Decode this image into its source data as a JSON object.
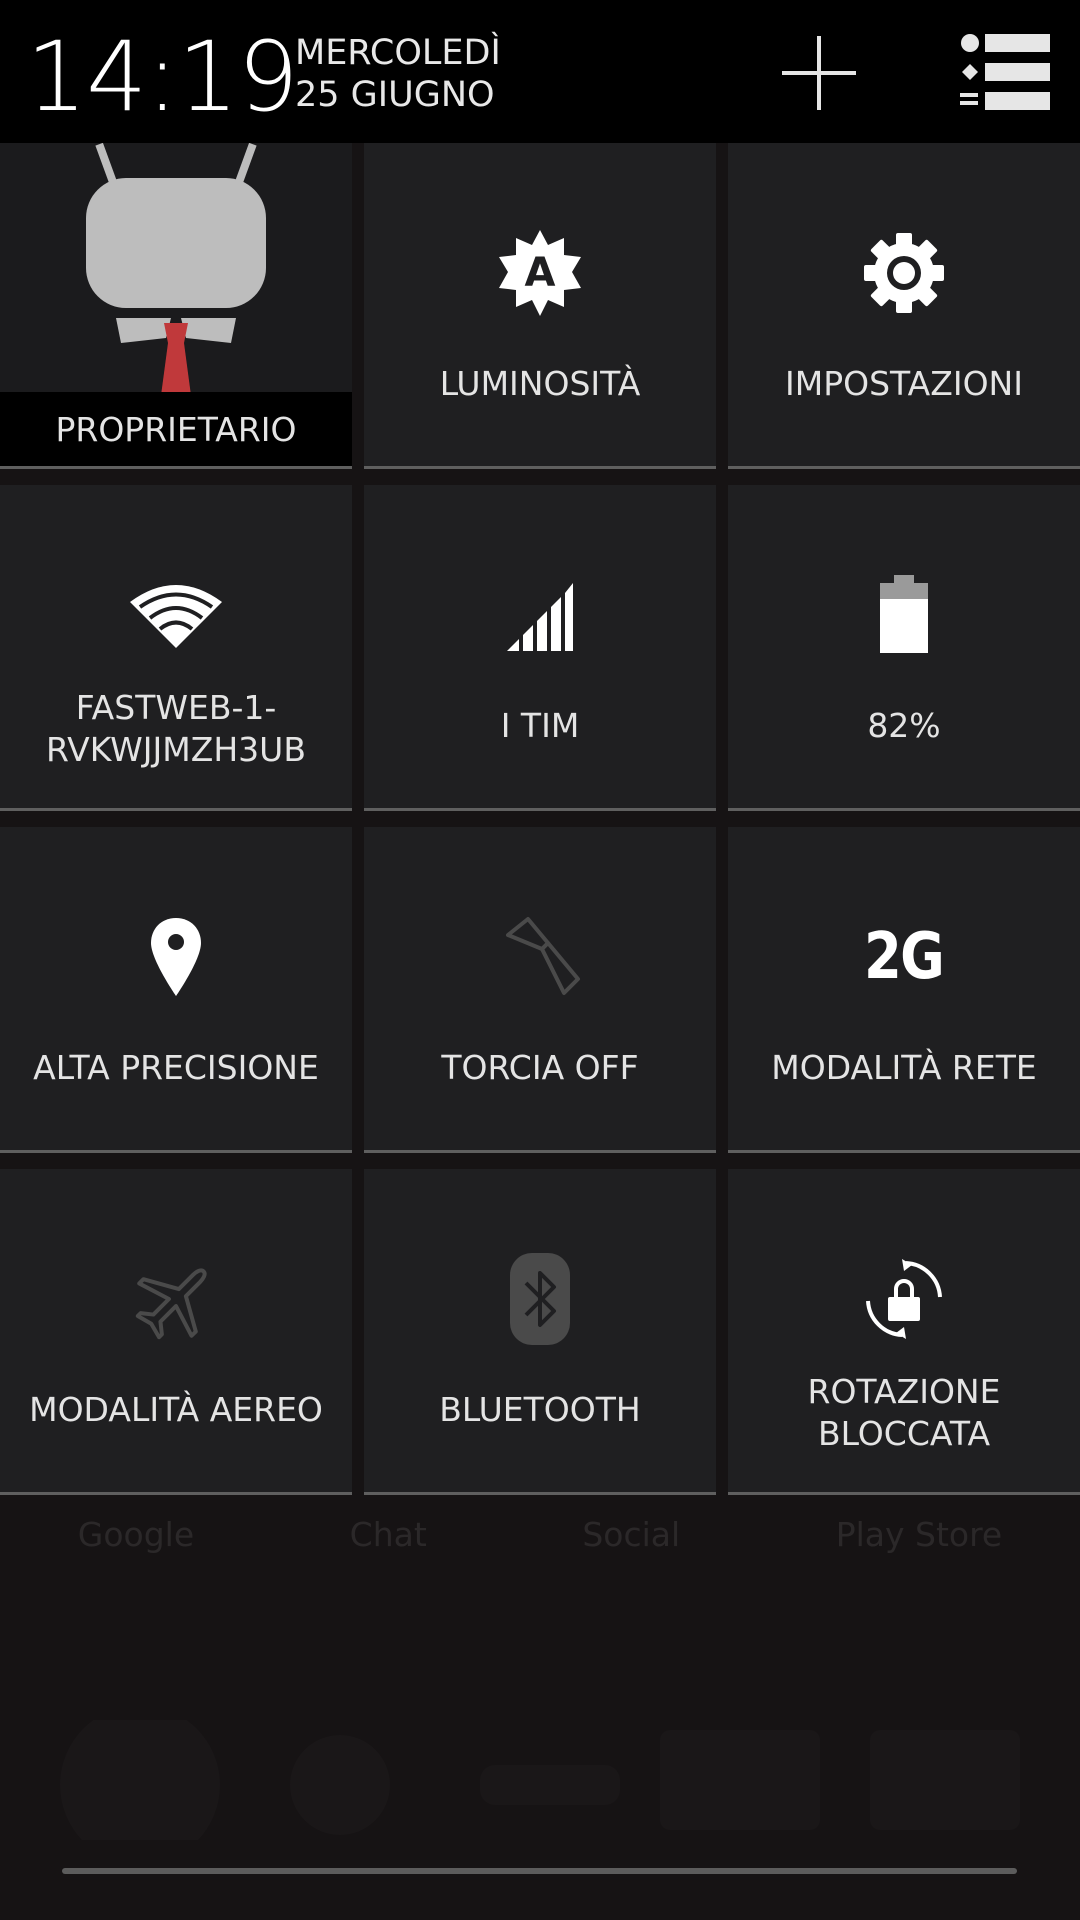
{
  "header": {
    "time": "14:19",
    "date_line1": "MERCOLEDÌ",
    "date_line2": "25 GIUGNO"
  },
  "tiles": {
    "owner": {
      "label": "PROPRIETARIO"
    },
    "brightness": {
      "label": "LUMINOSITÀ"
    },
    "settings": {
      "label": "IMPOSTAZIONI"
    },
    "wifi": {
      "label_line1": "FASTWEB-1-",
      "label_line2": "RVKWJJMZH3UB"
    },
    "mobile": {
      "label": "I TIM"
    },
    "battery": {
      "label": "82%"
    },
    "location": {
      "label": "ALTA PRECISIONE"
    },
    "torch": {
      "label": "TORCIA OFF"
    },
    "network_mode": {
      "label": "MODALITÀ RETE",
      "icon_text": "2G"
    },
    "airplane": {
      "label": "MODALITÀ AEREO"
    },
    "bluetooth": {
      "label": "BLUETOOTH"
    },
    "rotation": {
      "label_line1": "ROTAZIONE",
      "label_line2": "BLOCCATA"
    }
  },
  "background_labels": [
    "Google",
    "Chat",
    "Social",
    "Play Store"
  ],
  "colors": {
    "tile_bg": "#1f1f21",
    "header_bg": "#000000",
    "tie_red": "#c0393b",
    "dim_icon": "#4a4a4a"
  }
}
